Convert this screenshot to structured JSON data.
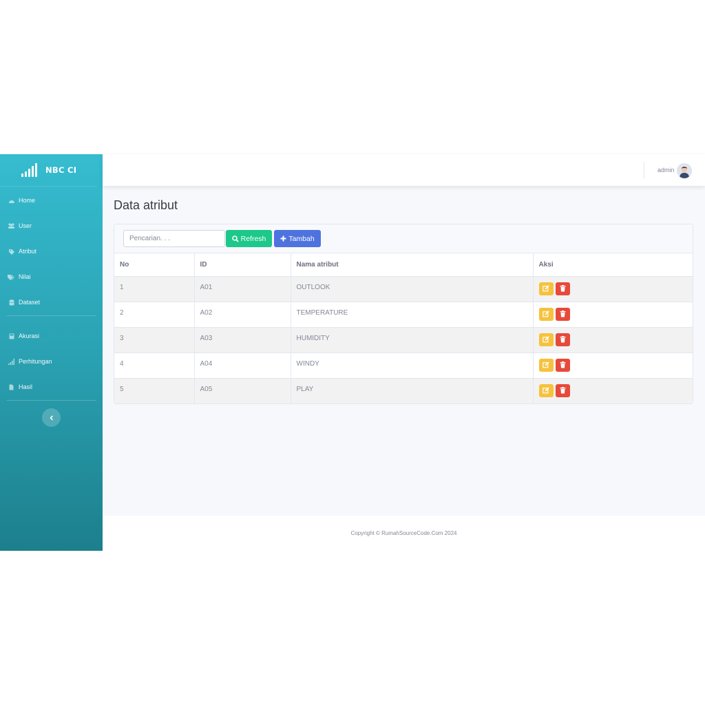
{
  "brand": {
    "name": "NBC CI",
    "icon": "signal-bars-icon",
    "color": "#36bcd0"
  },
  "sidebar": {
    "items": [
      {
        "label": "Home",
        "icon": "tachometer-icon"
      },
      {
        "label": "User",
        "icon": "users-icon"
      },
      {
        "label": "Atribut",
        "icon": "tag-icon"
      },
      {
        "label": "Nilai",
        "icon": "tags-icon"
      },
      {
        "label": "Dataset",
        "icon": "database-icon"
      },
      {
        "label": "Akurasi",
        "icon": "calculator-icon"
      },
      {
        "label": "Perhitungan",
        "icon": "signal-icon"
      },
      {
        "label": "Hasil",
        "icon": "file-icon"
      }
    ],
    "toggle_icon": "chevron-left-icon"
  },
  "topbar": {
    "username": "admin",
    "avatar_icon": "user-avatar-icon"
  },
  "page": {
    "title": "Data atribut"
  },
  "toolbar": {
    "search_placeholder": "Pencarian. . .",
    "refresh_label": "Refresh",
    "refresh_icon": "search-icon",
    "add_label": "Tambah",
    "add_icon": "plus-icon"
  },
  "table": {
    "headers": [
      "No",
      "ID",
      "Nama atribut",
      "Aksi"
    ],
    "rows": [
      {
        "no": "1",
        "id": "A01",
        "name": "OUTLOOK"
      },
      {
        "no": "2",
        "id": "A02",
        "name": "TEMPERATURE"
      },
      {
        "no": "3",
        "id": "A03",
        "name": "HUMIDITY"
      },
      {
        "no": "4",
        "id": "A04",
        "name": "WINDY"
      },
      {
        "no": "5",
        "id": "A05",
        "name": "PLAY"
      }
    ],
    "action_icons": {
      "edit": "edit-icon",
      "delete": "trash-icon"
    },
    "colors": {
      "edit": "#f6c23e",
      "delete": "#e74a3b"
    }
  },
  "footer": {
    "text": "Copyright © RumahSourceCode.Com 2024"
  },
  "colors": {
    "success": "#1cc88a",
    "primary": "#4e73df"
  }
}
